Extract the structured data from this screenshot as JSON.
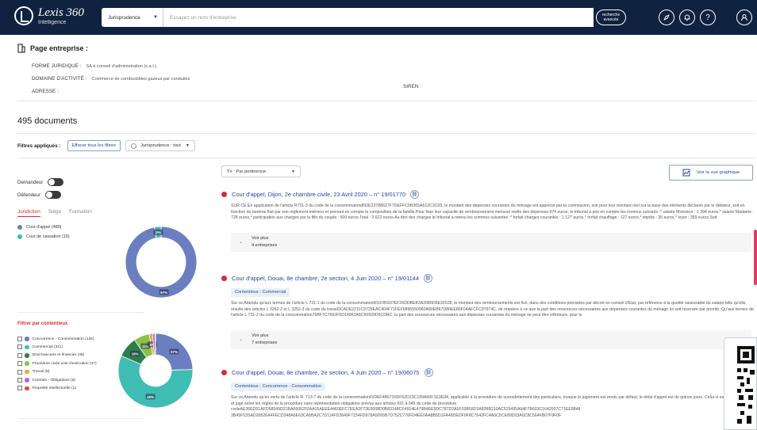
{
  "header": {
    "logo_name": "Lexis 360",
    "logo_sub": "Intelligence",
    "search_scope": "Jurisprudence",
    "search_placeholder": "Essayez un nom d'entreprise",
    "advanced_label_1": "recherche",
    "advanced_label_2": "avancée"
  },
  "company": {
    "title": "Page entreprise :",
    "forme_label": "FORME JURIDIQUE :",
    "forme_value": "SA à conseil d'administration (s.a.i.)",
    "domaine_label": "DOMAINE D'ACTIVITÉ :",
    "domaine_value": "Commerce de combustibles gazeux par conduites",
    "adresse_label": "ADRESSE :",
    "siren_label": "SIREN :"
  },
  "results": {
    "count": "495 documents",
    "filters_label": "Filtres appliqués :",
    "clear_label": "Effacer tous les filtres",
    "juris_pill": "Jurisprudence : tout",
    "sort_label": "Tri : Par pertinence",
    "graph_label": "Voir la vue graphique"
  },
  "sidebar": {
    "demandeur": "Demandeur",
    "defendeur": "Défendeur",
    "tabs": [
      "Juridiction",
      "Siège",
      "Formation"
    ],
    "juridiction_legend": [
      {
        "label": "Cour d'appel (480)",
        "color": "#6b7fc0"
      },
      {
        "label": "Cour de cassation (15)",
        "color": "#3fbcb3"
      }
    ],
    "ctx_title": "Filtrer par contentieux",
    "contentieux": [
      {
        "label": "Concurrence - Consommation (134)",
        "color": "#6b7fc0"
      },
      {
        "label": "Commercial (311)",
        "color": "#3fbcb3"
      },
      {
        "label": "Droit bancaire et financier (49)",
        "color": "#2e7d4f"
      },
      {
        "label": "Procédure civile voie d'exécution (37)",
        "color": "#8bc34a"
      },
      {
        "label": "Travail (8)",
        "color": "#f2a33a"
      },
      {
        "label": "Contrats - Obligations (6)",
        "color": "#b36bd3"
      },
      {
        "label": "Propriété intellectuelle (1)",
        "color": "#e0463c"
      }
    ]
  },
  "chart_data": [
    {
      "type": "pie",
      "categories": [
        "Cour d'appel",
        "Cour de cassation"
      ],
      "values": [
        480,
        15
      ],
      "slice_labels": [
        "97%",
        "3%"
      ]
    },
    {
      "type": "pie",
      "categories": [
        "Concurrence - Consommation",
        "Commercial",
        "Droit bancaire et financier",
        "Procédure civile voie d'exécution",
        "Travail",
        "Contrats - Obligations",
        "Propriété intellectuelle"
      ],
      "values": [
        134,
        311,
        49,
        37,
        8,
        6,
        1
      ],
      "slice_labels": [
        "37%",
        "49%",
        "18%",
        "11%",
        "5%",
        "",
        ""
      ]
    }
  ],
  "docs": [
    {
      "title": "Cour d'appel, Dijon, 2e chambre civile, 23 Avril 2020 – n° 19/01770",
      "tag": "",
      "text": "SUR CE En application de l'article R731-3 du code de la consommation892E23788627F7DEFFC5B365A612C3C05, le montant des dépenses courantes du ménage est apprécié par la commission, soit pour leur montant réel sur la base des éléments déclarés par le débiteur, soit en fonction du barème fixé par son règlement intérieur et prenant en compte la composition de la famille.Pour fixer leur capacité de remboursement mensuel réelle des dépenses 974 euros, le tribunal a pris en compte les revenus suivants :* salaire Monsieur : 1 394 euros,* salaire Madame : 728 euros,* participation aux charges par la fille du couple : 500 euros,Total : 2 622 euros.Au titre des charges le tribunal a retenu les sommes suivantes :* forfait charges courantes : 1 127 euros,* forfait chauffage : 127 euros,* impôts : 35 euros,* loyer : 359 euros,Soit",
      "voir_plus": "Voir plus",
      "entreprises": "4 entreprises"
    },
    {
      "title": "Cour d'appel, Douai, 8e chambre, 2e section, 4 Juin 2020 – n° 19/01144",
      "tag": "Contentieux : Commercial",
      "text": "Sur ce,Attendu qu'aux termes de l'article L 731-1 du code de la consommation601F85937EF26DDBEB3A2085D6E32028, le montant des remboursements est fixé, dans des conditions précisées par décret en conseil d'État, par référence à la quotité saisissable du salaire telle qu'elle résulte des articles L 3252-2 et L 3252-3 du code du travail3CADE2211C9725EAC464F71FEF6896550960A80EB67D80EE80F04AFCFC97974C, de manière à ce que la part des ressources nécessaires aux dépenses courantes du ménage lui soit réservée par priorité.;Qu'aux termes de l'article L 731-2 du code de la consommation76BF7C7662F0D14962A6C50939D5CDBC, la part des ressources nécessaires aux dépenses courantes du ménage ne peut être inférieure, pour le",
      "voir_plus": "Voir plus",
      "entreprises": "7 entreprises"
    },
    {
      "title": "Cour d'appel, Douai, 8e chambre, 2e section, 4 Juin 2020 – n° 19/06075",
      "tag": "Contentieux : Concurrence - Consommation",
      "text": "Sur ce,Attendu qu'en vertu de l'article R. 713-7 du code de la consommationF69EF4B6730DF62D23C199A60F1E3E94, applicable à la procédure de surendettement des particuliers, lorsque le jugement est rendu par défaut, le délai d'appel est de quinze jours. Celui-ci est formé, instruit et jugé selon les règles de la procédure sans représentation obligatoire prévue aux articles 931 à 949 du code de procédure civileAE36ED51AFD58549D21BA6606202AA15AEEE4460EFC7EEA2F73E9008D0B83148CF4914E479B4EE5DC787D2A5F03B59D3A838B210AC529495A94F7B603C1642937C71EE8848 3B45F53SAD26526A4FECD348A6E63CA5BA2C7D114FD3849F7154FD978A0D65B7D752C776FD4EE0AA8B5D1FA48DEDF0F8C7642FC4A5C5CE89D03A0C8C564FB07F9F0F",
      "voir_plus": "",
      "entreprises": ""
    }
  ]
}
